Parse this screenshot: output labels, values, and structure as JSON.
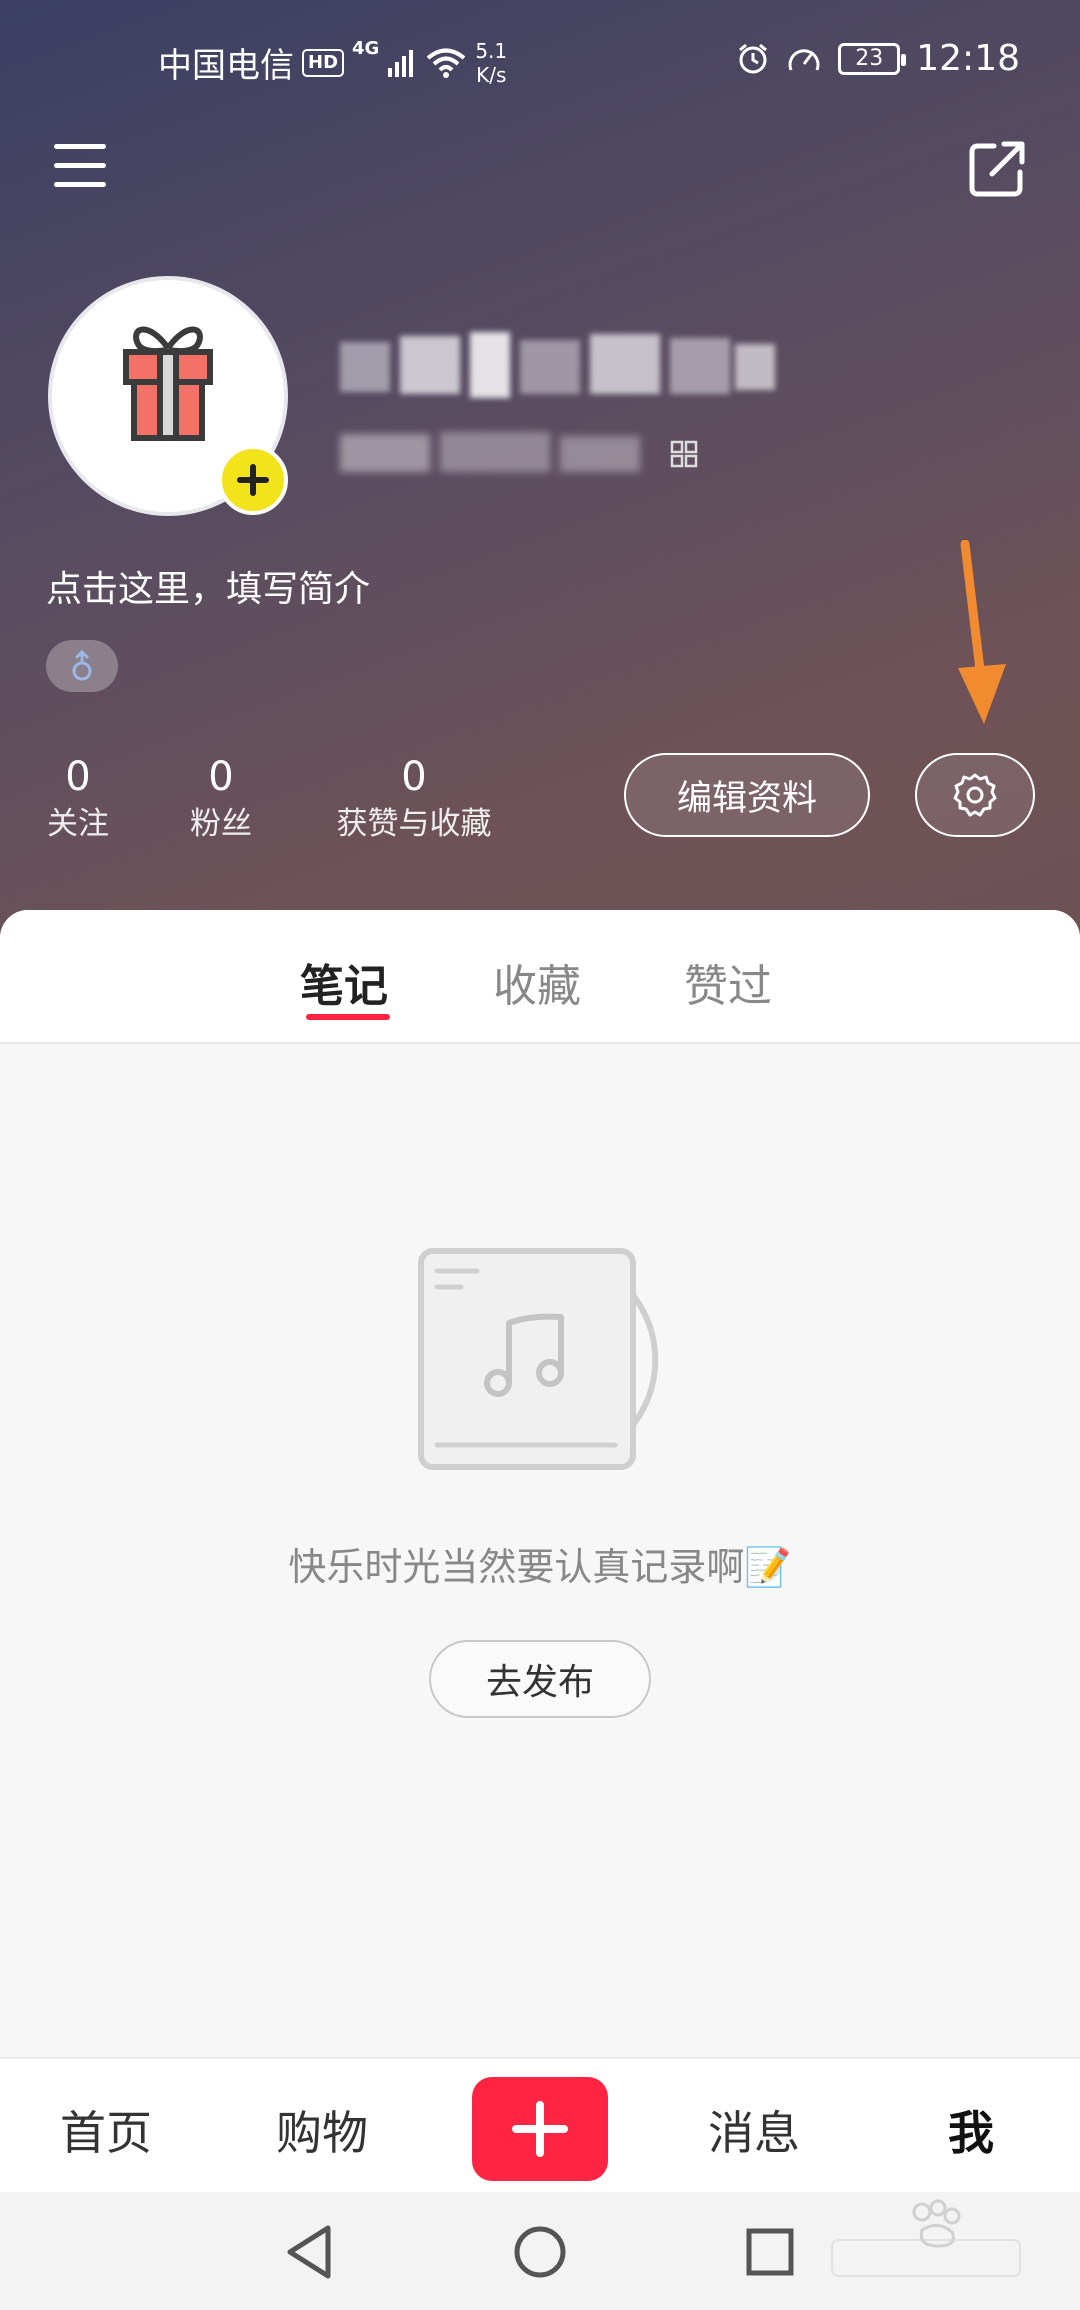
{
  "status_bar": {
    "carrier": "中国电信",
    "hd": "HD",
    "network": "4G",
    "speed_value": "5.1",
    "speed_unit": "K/s",
    "battery": "23",
    "time": "12:18"
  },
  "profile": {
    "bio_placeholder": "点击这里，填写简介"
  },
  "stats": [
    {
      "value": "0",
      "label": "关注"
    },
    {
      "value": "0",
      "label": "粉丝"
    },
    {
      "value": "0",
      "label": "获赞与收藏"
    }
  ],
  "actions": {
    "edit_profile": "编辑资料"
  },
  "tabs": [
    {
      "label": "笔记"
    },
    {
      "label": "收藏"
    },
    {
      "label": "赞过"
    }
  ],
  "empty_state": {
    "message": "快乐时光当然要认真记录啊📝",
    "button": "去发布"
  },
  "bottom_nav": [
    {
      "label": "首页"
    },
    {
      "label": "购物"
    },
    {
      "label": "消息"
    },
    {
      "label": "我"
    }
  ],
  "colors": {
    "accent": "#ff2442",
    "badge_yellow": "#f3e31b",
    "arrow_orange": "#f28b30"
  }
}
